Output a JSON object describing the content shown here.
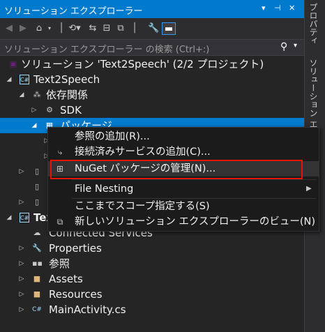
{
  "window": {
    "title": "ソリューション エクスプローラー",
    "pin_glyph": "▾ ⊣ ✕"
  },
  "toolbar": {
    "icons": [
      "back-icon",
      "forward-icon",
      "home-icon",
      "home-dropdown-icon",
      "history-icon",
      "sync-icon",
      "collapse-all-icon",
      "show-all-files-icon",
      "properties-icon",
      "preview-icon"
    ]
  },
  "search": {
    "placeholder": "ソリューション エクスプローラー の検索 (Ctrl+:)"
  },
  "side_tabs": [
    "プロパティ",
    "ソリューション エク"
  ],
  "tree": {
    "solution": "ソリューション 'Text2Speech' (2/2 プロジェクト)",
    "project1": "Text2Speech",
    "deps": "依存関係",
    "sdk": "SDK",
    "packages": "パッケージ",
    "project2": "Text",
    "connected": "Connected Services",
    "properties": "Properties",
    "refs": "参照",
    "assets": "Assets",
    "resources": "Resources",
    "mainactivity": "MainActivity.cs"
  },
  "context_menu": {
    "items": [
      {
        "label": "参照の追加(R)...",
        "icon": "add-reference-icon"
      },
      {
        "label": "接続済みサービスの追加(C)...",
        "icon": "connected-service-icon"
      },
      {
        "label": "NuGet パッケージの管理(N)...",
        "icon": "nuget-icon",
        "highlighted": true
      },
      {
        "label": "File Nesting",
        "submenu": true
      },
      {
        "label": "ここまでスコープ指定する(S)"
      },
      {
        "label": "新しいソリューション エクスプローラーのビュー(N)",
        "icon": "new-view-icon"
      }
    ]
  },
  "colors": {
    "accent": "#007acc",
    "highlight_box": "#e51400",
    "background": "#252526"
  }
}
